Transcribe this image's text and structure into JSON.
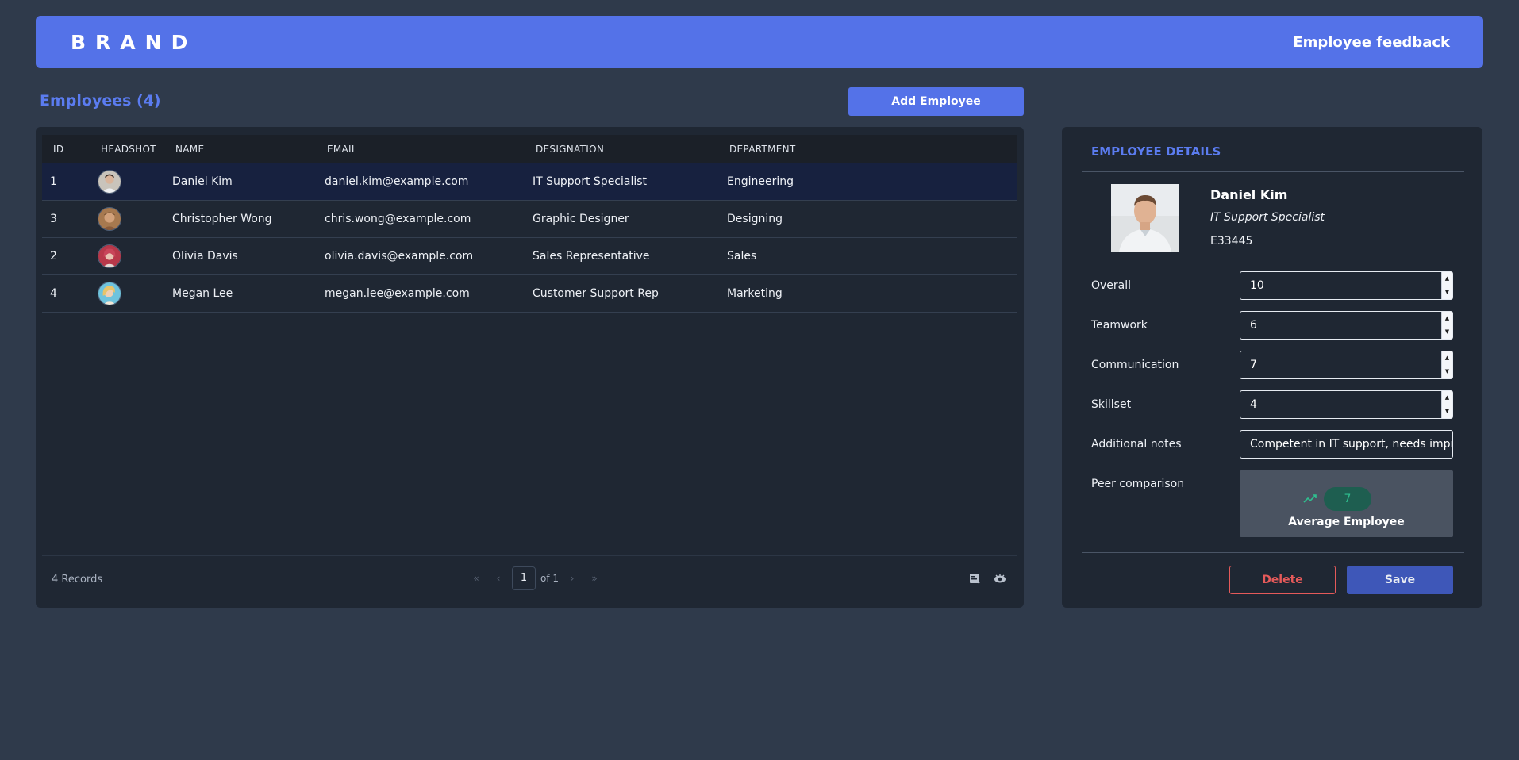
{
  "header": {
    "brand": "BRAND",
    "app_title": "Employee feedback"
  },
  "employees_section": {
    "heading": "Employees (4)",
    "add_button_label": "Add Employee"
  },
  "table": {
    "columns": [
      "ID",
      "HEADSHOT",
      "NAME",
      "EMAIL",
      "DESIGNATION",
      "DEPARTMENT"
    ],
    "rows": [
      {
        "id": "1",
        "name": "Daniel Kim",
        "email": "daniel.kim@example.com",
        "designation": "IT Support Specialist",
        "department": "Engineering",
        "selected": true
      },
      {
        "id": "3",
        "name": "Christopher Wong",
        "email": "chris.wong@example.com",
        "designation": "Graphic Designer",
        "department": "Designing",
        "selected": false
      },
      {
        "id": "2",
        "name": "Olivia Davis",
        "email": "olivia.davis@example.com",
        "designation": "Sales Representative",
        "department": "Sales",
        "selected": false
      },
      {
        "id": "4",
        "name": "Megan Lee",
        "email": "megan.lee@example.com",
        "designation": "Customer Support Rep",
        "department": "Marketing",
        "selected": false
      }
    ],
    "footer": {
      "records": "4 Records",
      "page_current": "1",
      "page_of": "of 1"
    }
  },
  "details": {
    "title": "EMPLOYEE DETAILS",
    "name": "Daniel Kim",
    "role": "IT Support Specialist",
    "code": "E33445",
    "fields": {
      "overall": {
        "label": "Overall",
        "value": "10"
      },
      "teamwork": {
        "label": "Teamwork",
        "value": "6"
      },
      "communication": {
        "label": "Communication",
        "value": "7"
      },
      "skillset": {
        "label": "Skillset",
        "value": "4"
      },
      "notes": {
        "label": "Additional notes",
        "value": "Competent in IT support, needs improvement in communication"
      },
      "peer": {
        "label": "Peer comparison",
        "score": "7",
        "caption": "Average Employee"
      }
    },
    "delete_label": "Delete",
    "save_label": "Save"
  },
  "colors": {
    "accent": "#5472e8",
    "danger": "#e55a5a",
    "success": "#2fbf8f",
    "background": "#2f3a4b",
    "panel": "#1f2733"
  }
}
